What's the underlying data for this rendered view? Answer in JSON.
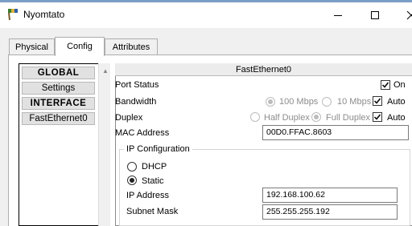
{
  "window": {
    "title": "Nyomtato",
    "controls": {
      "minimize": "minimize-icon",
      "maximize": "maximize-icon",
      "close": "close-icon"
    }
  },
  "tabs": [
    {
      "label": "Physical"
    },
    {
      "label": "Config"
    },
    {
      "label": "Attributes"
    }
  ],
  "active_tab": "Config",
  "sidebar": {
    "items": [
      {
        "label": "GLOBAL",
        "header": true
      },
      {
        "label": "Settings",
        "header": false
      },
      {
        "label": "INTERFACE",
        "header": true
      },
      {
        "label": "FastEthernet0",
        "header": false
      }
    ]
  },
  "panel": {
    "title": "FastEthernet0",
    "port_status": {
      "label": "Port Status",
      "on_label": "On",
      "on_checked": true
    },
    "bandwidth": {
      "label": "Bandwidth",
      "opt1": "100 Mbps",
      "opt2": "10 Mbps",
      "auto_label": "Auto",
      "auto_checked": true
    },
    "duplex": {
      "label": "Duplex",
      "opt1": "Half Duplex",
      "opt2": "Full Duplex",
      "auto_label": "Auto",
      "auto_checked": true
    },
    "mac": {
      "label": "MAC Address",
      "value": "00D0.FFAC.8603"
    },
    "ip_config": {
      "legend": "IP Configuration",
      "dhcp_label": "DHCP",
      "static_label": "Static",
      "selected": "Static",
      "ip_label": "IP Address",
      "ip_value": "192.168.100.62",
      "mask_label": "Subnet Mask",
      "mask_value": "255.255.255.192"
    }
  }
}
